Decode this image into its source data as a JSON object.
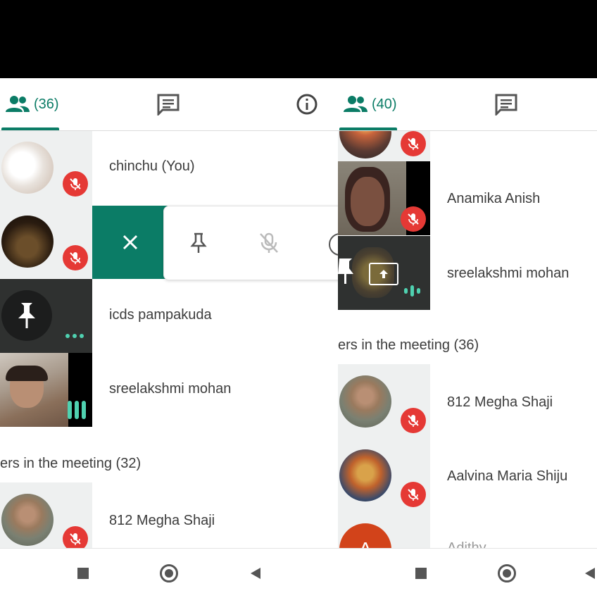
{
  "status_bar": {},
  "left": {
    "tabs": {
      "people_count": "(36)"
    },
    "participants": [
      {
        "name": "chinchu (You)",
        "muted": true
      },
      {
        "name": "",
        "muted": true
      },
      {
        "name": "icds pampakuda",
        "muted": false
      },
      {
        "name": "sreelakshmi mohan",
        "muted": false
      }
    ],
    "section_title": "ers in the meeting (32)",
    "others": [
      {
        "name": "812 Megha Shaji",
        "muted": true
      }
    ],
    "action_bar": {
      "close": "close",
      "pin": "pin",
      "mute": "mute"
    }
  },
  "right": {
    "tabs": {
      "people_count": "(40)"
    },
    "participants": [
      {
        "name": "Anamika Anish",
        "muted": true
      },
      {
        "name": "sreelakshmi mohan",
        "presenting": true
      }
    ],
    "section_title": "ers in the meeting (36)",
    "others": [
      {
        "name": "812 Megha Shaji",
        "muted": true
      },
      {
        "name": "Aalvina Maria Shiju",
        "muted": true
      },
      {
        "name": "Adithy...",
        "initial": "A"
      }
    ]
  },
  "colors": {
    "accent": "#0b7c66",
    "mute_red": "#e53935"
  },
  "nav": {
    "items": [
      "recent-apps",
      "home",
      "back"
    ]
  }
}
